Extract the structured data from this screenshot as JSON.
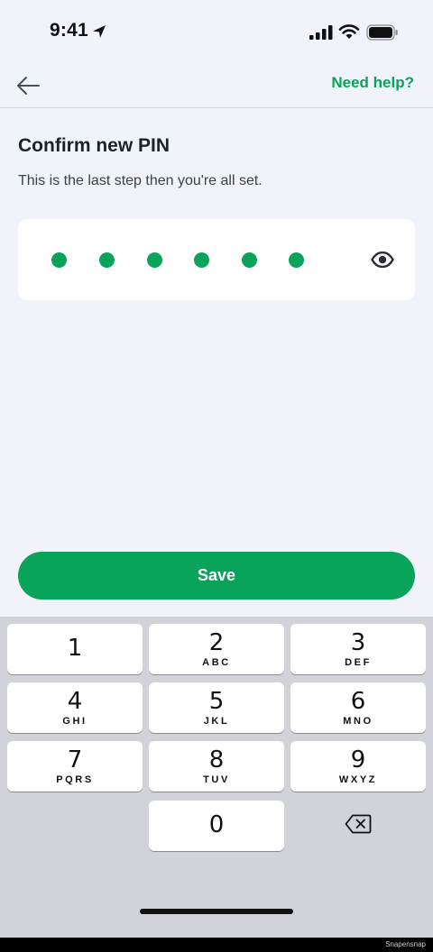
{
  "status_bar": {
    "time": "9:41",
    "icons": [
      "location-arrow-icon",
      "cellular-signal-icon",
      "wifi-icon",
      "battery-icon"
    ]
  },
  "nav": {
    "back_icon": "arrow-left-icon",
    "help_label": "Need help?"
  },
  "page": {
    "title": "Confirm new PIN",
    "subtitle": "This is the last step then you're all set."
  },
  "pin": {
    "entered_digits": 6,
    "visibility_icon": "eye-icon"
  },
  "save_label": "Save",
  "keyboard": {
    "rows": [
      [
        {
          "digit": "1",
          "letters": ""
        },
        {
          "digit": "2",
          "letters": "ABC"
        },
        {
          "digit": "3",
          "letters": "DEF"
        }
      ],
      [
        {
          "digit": "4",
          "letters": "GHI"
        },
        {
          "digit": "5",
          "letters": "JKL"
        },
        {
          "digit": "6",
          "letters": "MNO"
        }
      ],
      [
        {
          "digit": "7",
          "letters": "PQRS"
        },
        {
          "digit": "8",
          "letters": "TUV"
        },
        {
          "digit": "9",
          "letters": "WXYZ"
        }
      ],
      [
        {
          "digit": "0",
          "letters": ""
        }
      ]
    ],
    "delete_icon": "backspace-icon"
  },
  "watermark": "Snapensnap",
  "colors": {
    "accent": "#0aa35a",
    "background": "#f1f3fb",
    "keyboard": "#d1d3d9"
  }
}
